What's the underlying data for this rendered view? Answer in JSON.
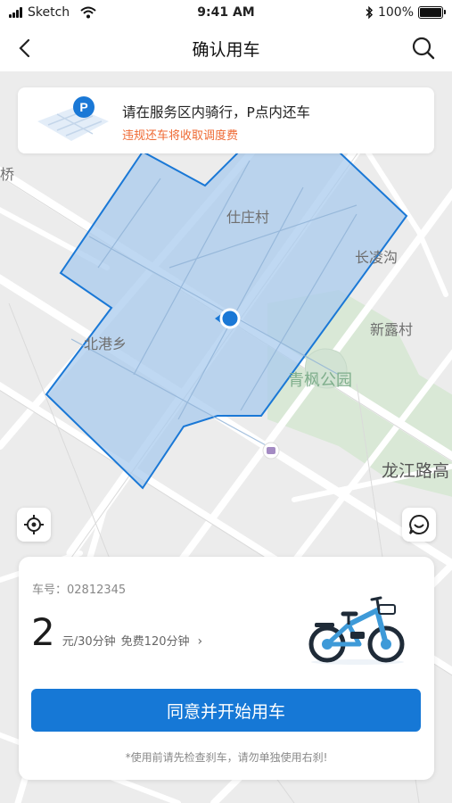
{
  "status_bar": {
    "carrier": "Sketch",
    "time": "9:41 AM",
    "battery": "100%"
  },
  "nav": {
    "title": "确认用车",
    "back_icon": "chevron-left-icon",
    "search_icon": "search-icon"
  },
  "notice": {
    "line1": "请在服务区内骑行，P点内还车",
    "line2": "违规还车将收取调度费",
    "icon": "parking-map-icon"
  },
  "map": {
    "labels": {
      "bridge": "桥",
      "shizhuang": "仕庄村",
      "changling": "长凌沟",
      "beigang": "北港乡",
      "xinlu": "新露村",
      "qingfeng": "青枫公园",
      "longjiang": "龙江路高"
    },
    "zone_color": "#a9cbee",
    "zone_border": "#1a78d6"
  },
  "panel": {
    "car_label": "车号：",
    "car_number": "02812345",
    "price": "2",
    "unit": "元/30分钟",
    "free": "免费120分钟",
    "chevron": "›",
    "button": "同意并开始用车",
    "tip": "*使用前请先检查刹车，请勿单独使用右刹!",
    "accent": "#1678d6"
  }
}
